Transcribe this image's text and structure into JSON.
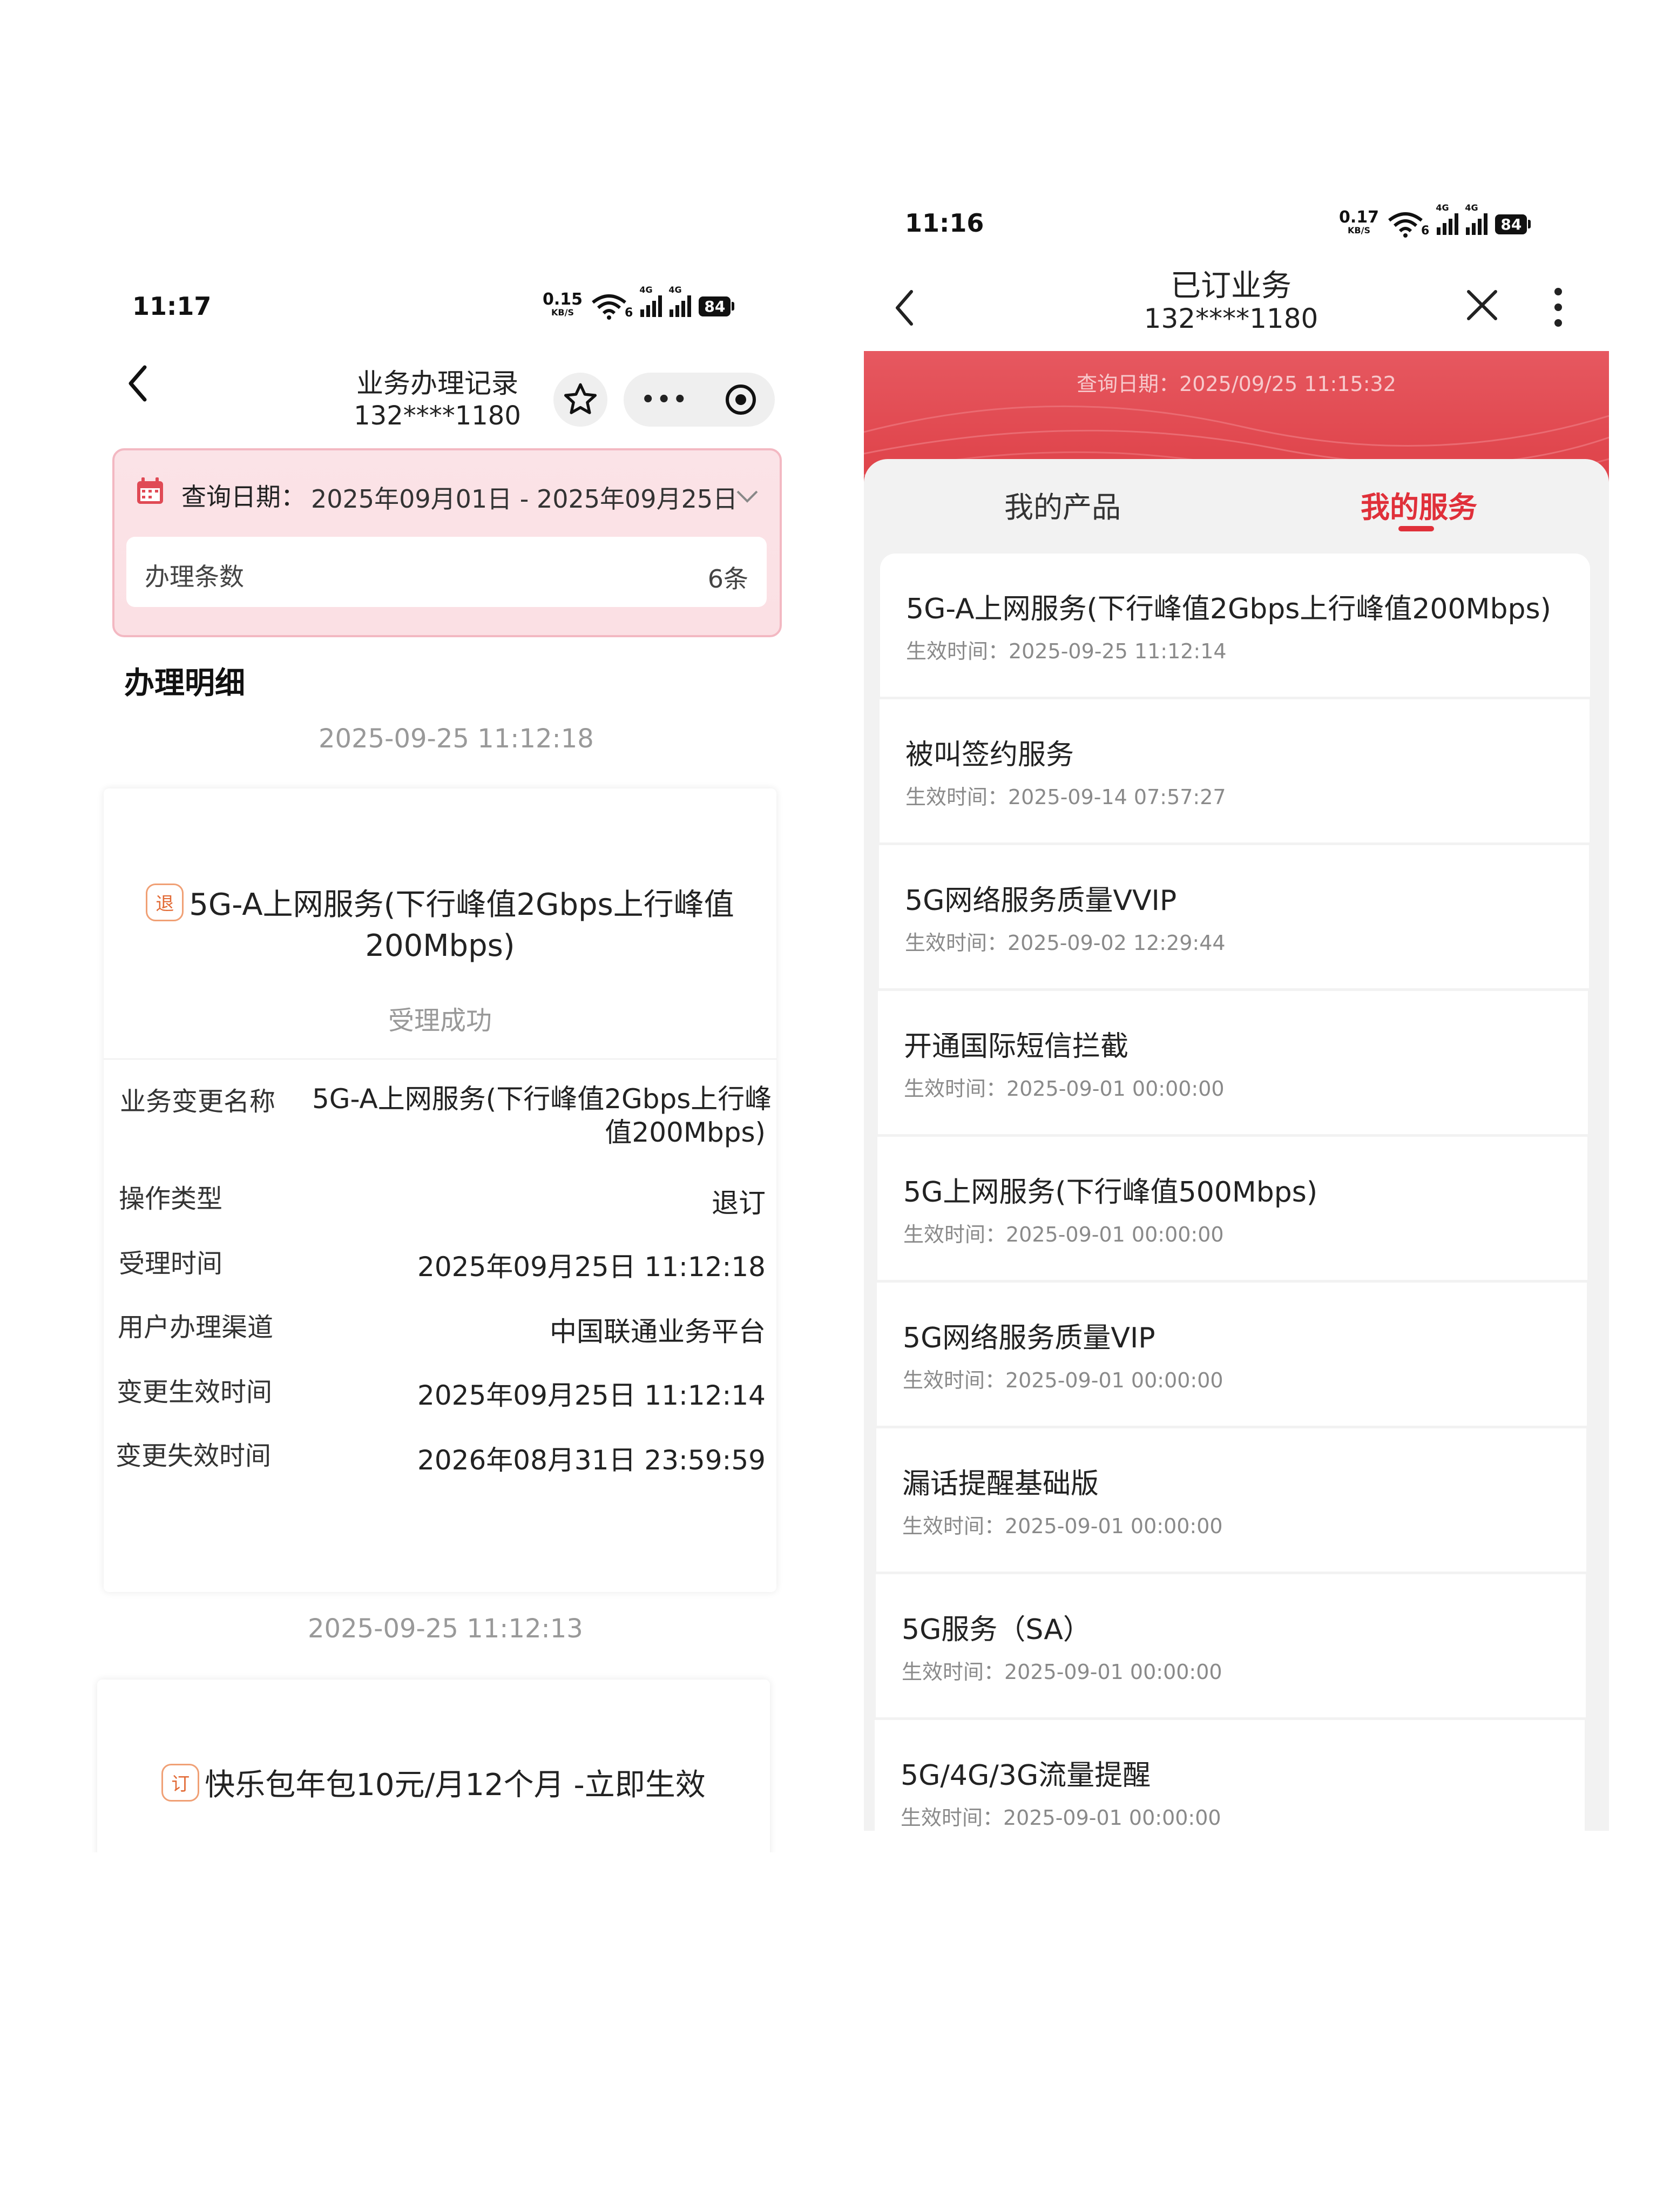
{
  "left": {
    "status_bar": {
      "time": "11:17",
      "speed": "0.15",
      "speed_unit": "KB/S",
      "wifi_num": "6",
      "net1": "4G",
      "net2": "4G",
      "battery": "84"
    },
    "nav": {
      "title": "业务办理记录",
      "subtitle": "132****1180"
    },
    "query": {
      "label": "查询日期：",
      "range": "2025年09月01日 - 2025年09月25日",
      "count_label": "办理条数",
      "count_value": "6条"
    },
    "section_title": "办理明细",
    "records": [
      {
        "timestamp": "2025-09-25 11:12:18",
        "badge": "退",
        "title_line1": "5G-A上网服务(下行峰值2Gbps上行峰值",
        "title_line2": "200Mbps)",
        "status": "受理成功",
        "rows": [
          {
            "label": "业务变更名称",
            "value_line1": "5G-A上网服务(下行峰值2Gbps上行峰",
            "value_line2": "值200Mbps)"
          },
          {
            "label": "操作类型",
            "value": "退订"
          },
          {
            "label": "受理时间",
            "value": "2025年09月25日 11:12:18"
          },
          {
            "label": "用户办理渠道",
            "value": "中国联通业务平台"
          },
          {
            "label": "变更生效时间",
            "value": "2025年09月25日 11:12:14"
          },
          {
            "label": "变更失效时间",
            "value": "2026年08月31日 23:59:59"
          }
        ]
      },
      {
        "timestamp": "2025-09-25 11:12:13",
        "badge": "订",
        "title_line1": "快乐包年包10元/月12个月 -立即生效"
      }
    ],
    "colors": {
      "accent_pink_border": "#f3b8c2",
      "badge_orange": "#e26a35"
    }
  },
  "right": {
    "status_bar": {
      "time": "11:16",
      "speed": "0.17",
      "speed_unit": "KB/S",
      "wifi_num": "6",
      "net1": "4G",
      "net2": "4G",
      "battery": "84"
    },
    "nav": {
      "title": "已订业务",
      "subtitle": "132****1180"
    },
    "query_date": "查询日期：2025/09/25 11:15:32",
    "tabs": [
      {
        "label": "我的产品",
        "active": false
      },
      {
        "label": "我的服务",
        "active": true
      }
    ],
    "time_prefix": "生效时间：",
    "services": [
      {
        "name": "5G-A上网服务(下行峰值2Gbps上行峰值200Mbps)",
        "time": "生效时间：2025-09-25 11:12:14"
      },
      {
        "name": "被叫签约服务",
        "time": "生效时间：2025-09-14 07:57:27"
      },
      {
        "name": "5G网络服务质量VVIP",
        "time": "生效时间：2025-09-02 12:29:44"
      },
      {
        "name": "开通国际短信拦截",
        "time": "生效时间：2025-09-01 00:00:00"
      },
      {
        "name": "5G上网服务(下行峰值500Mbps)",
        "time": "生效时间：2025-09-01 00:00:00"
      },
      {
        "name": "5G网络服务质量VIP",
        "time": "生效时间：2025-09-01 00:00:00"
      },
      {
        "name": "漏话提醒基础版",
        "time": "生效时间：2025-09-01 00:00:00"
      },
      {
        "name": "5G服务（SA）",
        "time": "生效时间：2025-09-01 00:00:00"
      },
      {
        "name": "5G/4G/3G流量提醒",
        "time": "生效时间：2025-09-01 00:00:00"
      }
    ],
    "colors": {
      "brand_red": "#e0464d",
      "active_tab": "#e0303a"
    }
  }
}
